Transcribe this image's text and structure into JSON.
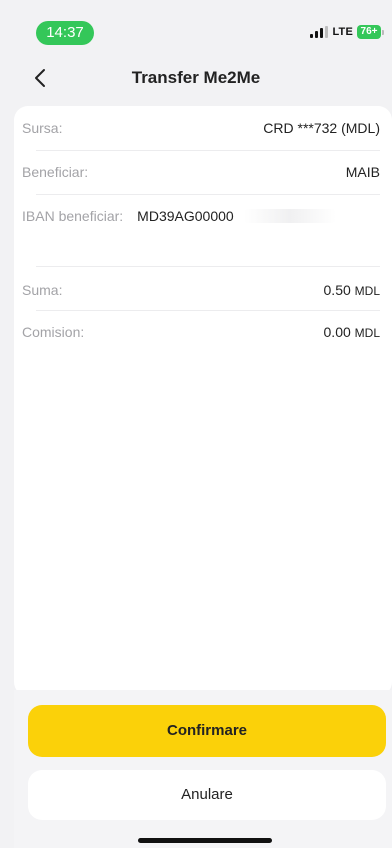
{
  "status_bar": {
    "time": "14:37",
    "network": "LTE",
    "battery": "76+",
    "battery_color": "#34c759",
    "time_pill_color": "#34c759"
  },
  "nav": {
    "title": "Transfer Me2Me",
    "back_icon": "chevron-left-icon"
  },
  "details": {
    "sursa": {
      "label": "Sursa:",
      "value": "CRD ***732 (MDL)"
    },
    "beneficiar": {
      "label": "Beneficiar:",
      "value": "MAIB"
    },
    "iban": {
      "label": "IBAN beneficiar:",
      "value": "MD39AG00000"
    },
    "suma": {
      "label": "Suma:",
      "amount": "0.50",
      "currency": "MDL"
    },
    "comision": {
      "label": "Comision:",
      "amount": "0.00",
      "currency": "MDL"
    }
  },
  "actions": {
    "confirm_label": "Confirmare",
    "cancel_label": "Anulare",
    "confirm_color": "#fbd109"
  }
}
